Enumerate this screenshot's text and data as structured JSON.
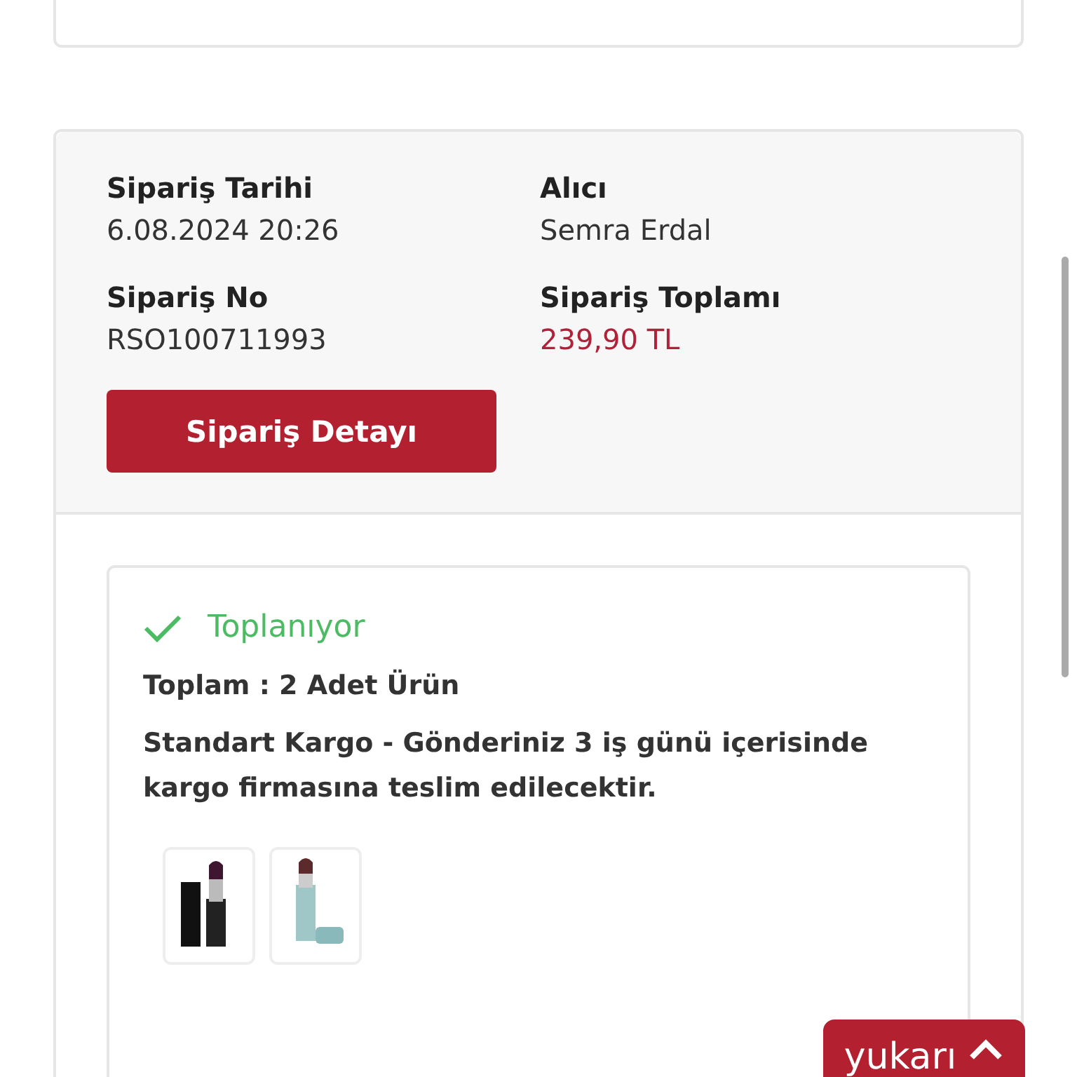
{
  "order": {
    "fields": [
      {
        "label": "Sipariş Tarihi",
        "value": "6.08.2024 20:26",
        "kind": "plain"
      },
      {
        "label": "Alıcı",
        "value": "Semra Erdal",
        "kind": "plain"
      },
      {
        "label": "Sipariş No",
        "value": "RSO100711993",
        "kind": "plain"
      },
      {
        "label": "Sipariş Toplamı",
        "value": "239,90 TL",
        "kind": "price"
      }
    ],
    "detail_button": "Sipariş Detayı",
    "shipment": {
      "status": "Toplanıyor",
      "total": "Toplam : 2 Adet Ürün",
      "note": "Standart Kargo - Gönderiniz 3 iş günü içerisinde kargo firmasına teslim edilecektir."
    }
  },
  "back_to_top": "yukarı"
}
